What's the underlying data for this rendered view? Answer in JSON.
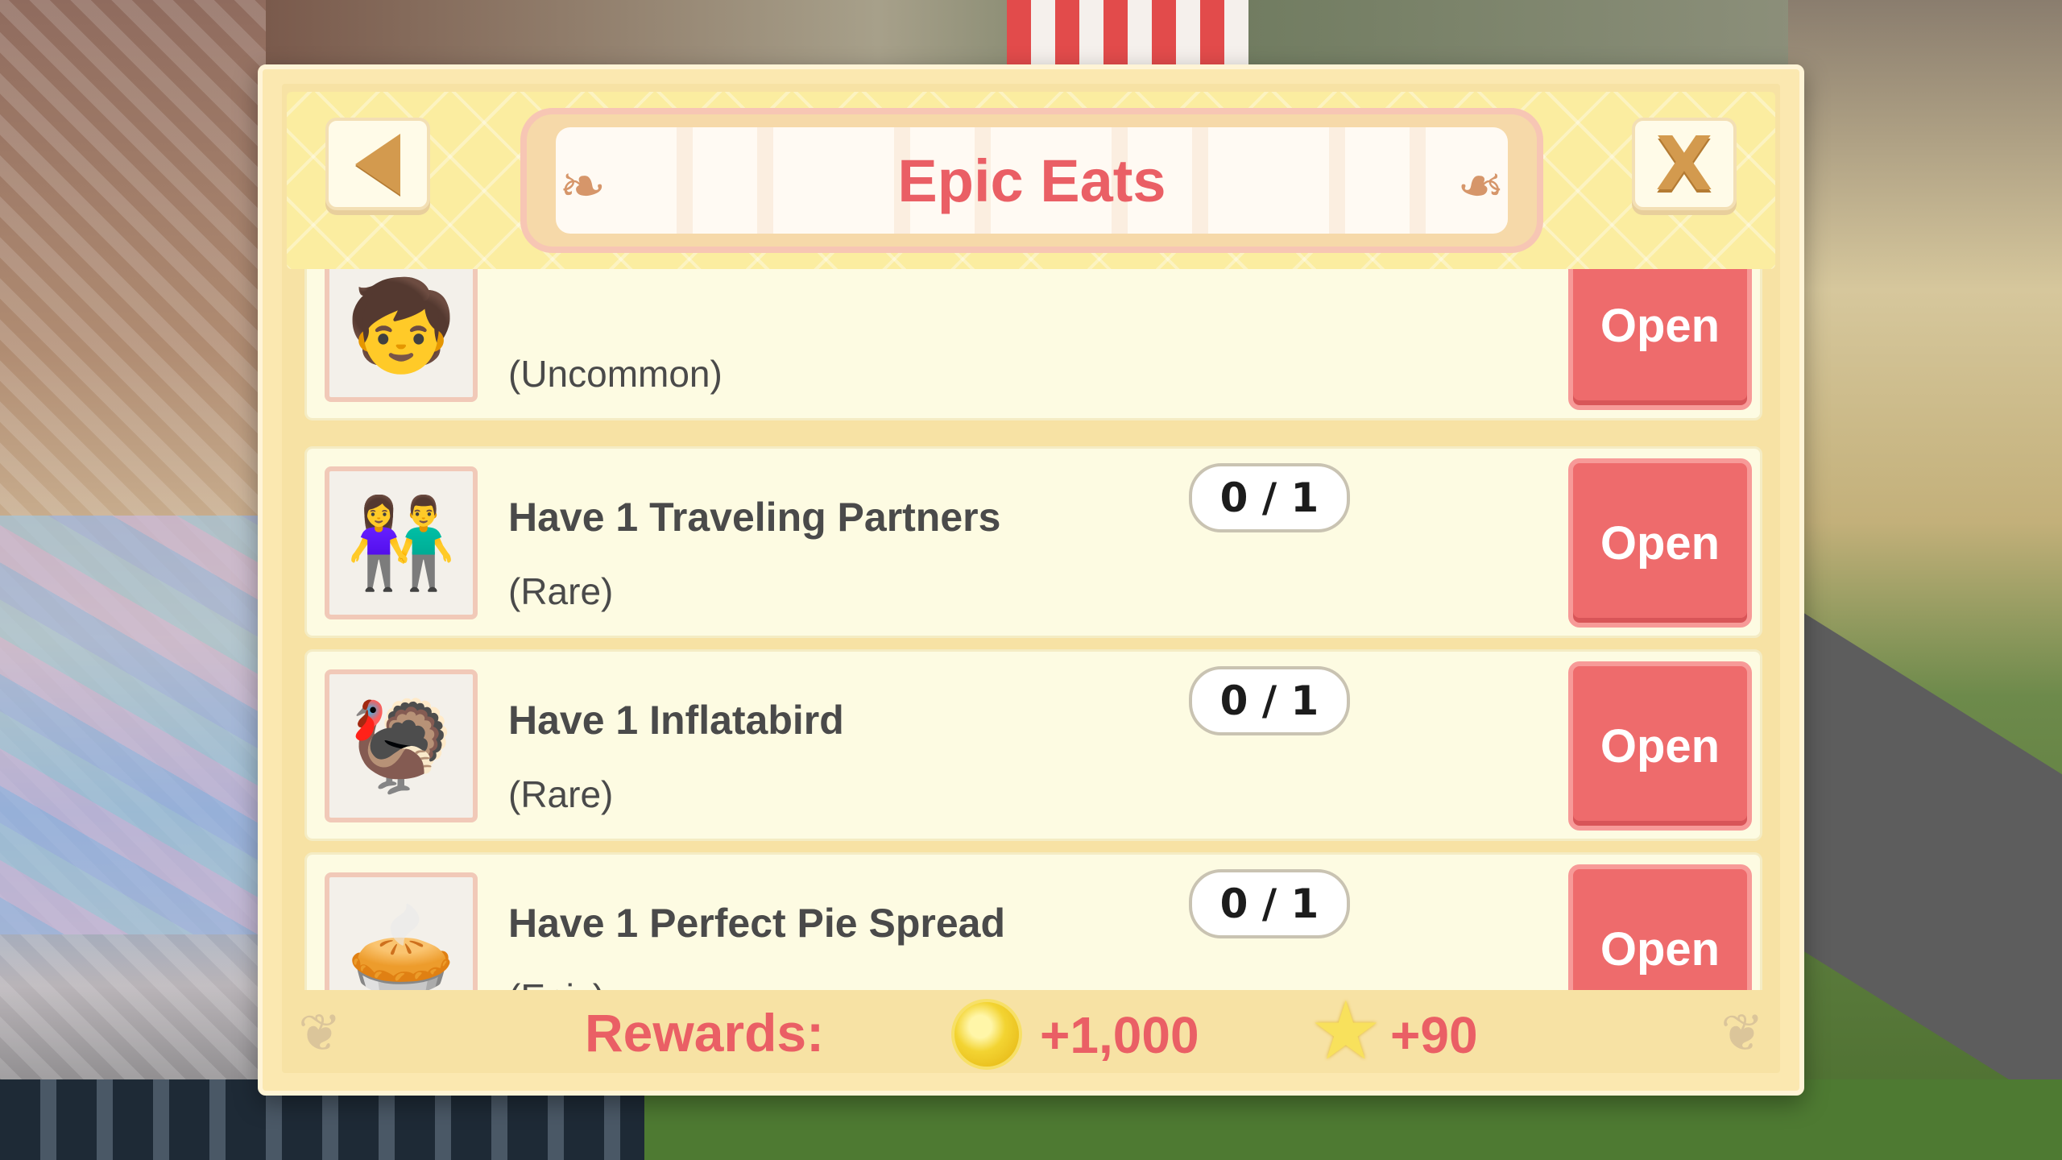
{
  "dialog": {
    "title": "Epic Eats",
    "back_icon": "back-arrow-icon",
    "close_label": "X"
  },
  "tasks": [
    {
      "title": "",
      "rarity": "(Uncommon)",
      "progress": "",
      "button": "Open",
      "thumb_icon": "traveling-kids-icon"
    },
    {
      "title": "Have 1 Traveling Partners",
      "rarity": "(Rare)",
      "progress": "0 / 1",
      "button": "Open",
      "thumb_icon": "traveling-partners-icon"
    },
    {
      "title": "Have 1 Inflatabird",
      "rarity": "(Rare)",
      "progress": "0 / 1",
      "button": "Open",
      "thumb_icon": "turkey-icon"
    },
    {
      "title": "Have 1 Perfect Pie Spread",
      "rarity": "(Epic)",
      "progress": "0 / 1",
      "button": "Open",
      "thumb_icon": "pie-table-icon"
    }
  ],
  "rewards": {
    "label": "Rewards:",
    "coins": "+1,000",
    "stars": "+90"
  },
  "colors": {
    "title": "#ea5f65",
    "button": "#ee6b6c",
    "panel": "#fbe8b0",
    "row": "#fdfbe2"
  }
}
